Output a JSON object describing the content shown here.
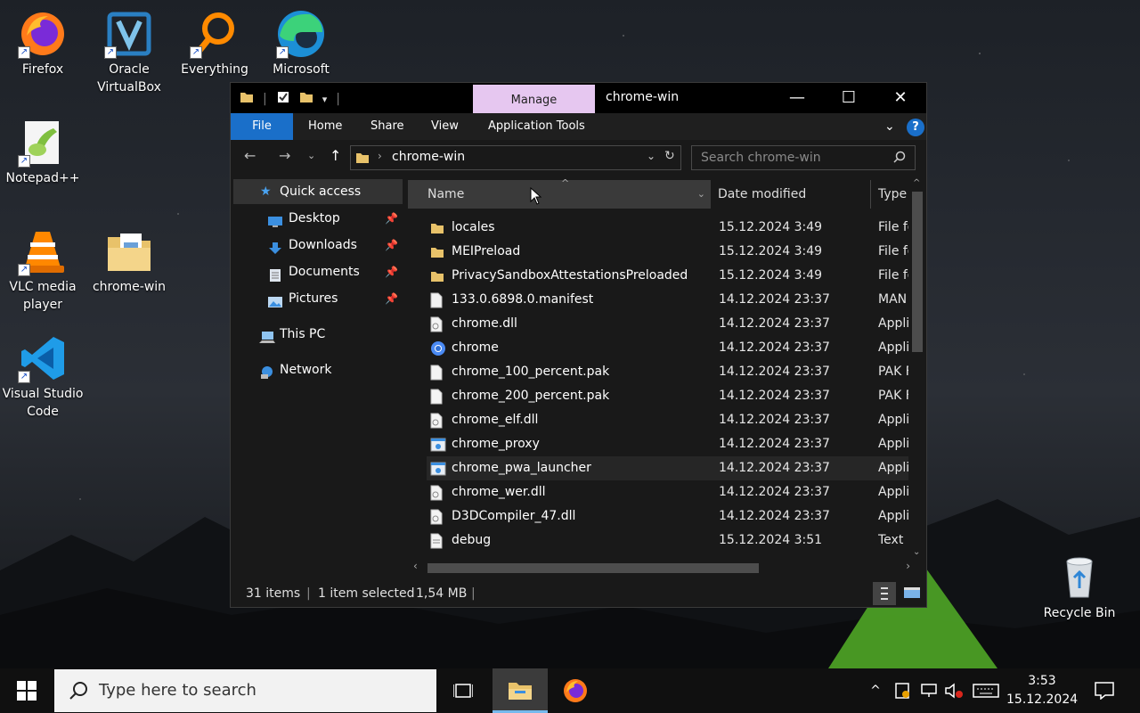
{
  "desktop_icons": [
    {
      "label": "Firefox",
      "icon": "firefox-icon"
    },
    {
      "label": "Oracle VirtualBox",
      "icon": "virtualbox-icon"
    },
    {
      "label": "Everything",
      "icon": "everything-search-icon"
    },
    {
      "label": "Microsoft",
      "icon": "edge-icon"
    },
    {
      "label": "Notepad++",
      "icon": "notepadpp-icon"
    },
    {
      "label": "VLC media player",
      "icon": "vlc-icon"
    },
    {
      "label": "chrome-win",
      "icon": "folder-icon"
    },
    {
      "label": "Visual Studio Code",
      "icon": "vscode-icon"
    },
    {
      "label": "Recycle Bin",
      "icon": "recycle-bin-icon"
    }
  ],
  "window": {
    "title": "chrome-win",
    "manage_tab": "Manage",
    "ribbon_tabs": [
      "File",
      "Home",
      "Share",
      "View",
      "Application Tools"
    ],
    "help": "?",
    "address": "chrome-win",
    "search_placeholder": "Search chrome-win",
    "columns": [
      "Name",
      "Date modified",
      "Type"
    ],
    "nav": [
      {
        "label": "Quick access",
        "icon": "star-icon"
      },
      {
        "label": "Desktop",
        "icon": "desktop-icon"
      },
      {
        "label": "Downloads",
        "icon": "download-arrow-icon"
      },
      {
        "label": "Documents",
        "icon": "documents-icon"
      },
      {
        "label": "Pictures",
        "icon": "pictures-icon"
      },
      {
        "label": "This PC",
        "icon": "computer-icon"
      },
      {
        "label": "Network",
        "icon": "network-icon"
      }
    ],
    "files": [
      {
        "name": "locales",
        "date": "15.12.2024 3:49",
        "type": "File fo",
        "icon": "folder"
      },
      {
        "name": "MEIPreload",
        "date": "15.12.2024 3:49",
        "type": "File fo",
        "icon": "folder"
      },
      {
        "name": "PrivacySandboxAttestationsPreloaded",
        "date": "15.12.2024 3:49",
        "type": "File fo",
        "icon": "folder"
      },
      {
        "name": "133.0.6898.0.manifest",
        "date": "14.12.2024 23:37",
        "type": "MAN",
        "icon": "file"
      },
      {
        "name": "chrome.dll",
        "date": "14.12.2024 23:37",
        "type": "Appli",
        "icon": "dll"
      },
      {
        "name": "chrome",
        "date": "14.12.2024 23:37",
        "type": "Appli",
        "icon": "chrome"
      },
      {
        "name": "chrome_100_percent.pak",
        "date": "14.12.2024 23:37",
        "type": "PAK F",
        "icon": "file"
      },
      {
        "name": "chrome_200_percent.pak",
        "date": "14.12.2024 23:37",
        "type": "PAK F",
        "icon": "file"
      },
      {
        "name": "chrome_elf.dll",
        "date": "14.12.2024 23:37",
        "type": "Appli",
        "icon": "dll"
      },
      {
        "name": "chrome_proxy",
        "date": "14.12.2024 23:37",
        "type": "Appli",
        "icon": "exe"
      },
      {
        "name": "chrome_pwa_launcher",
        "date": "14.12.2024 23:37",
        "type": "Appli",
        "icon": "exe"
      },
      {
        "name": "chrome_wer.dll",
        "date": "14.12.2024 23:37",
        "type": "Appli",
        "icon": "dll"
      },
      {
        "name": "D3DCompiler_47.dll",
        "date": "14.12.2024 23:37",
        "type": "Appli",
        "icon": "dll"
      },
      {
        "name": "debug",
        "date": "15.12.2024 3:51",
        "type": "Text I",
        "icon": "text"
      }
    ],
    "status": {
      "items": "31 items",
      "selected": "1 item selected",
      "size": "1,54 MB"
    }
  },
  "taskbar": {
    "search_placeholder": "Type here to search",
    "time": "3:53",
    "date": "15.12.2024"
  }
}
